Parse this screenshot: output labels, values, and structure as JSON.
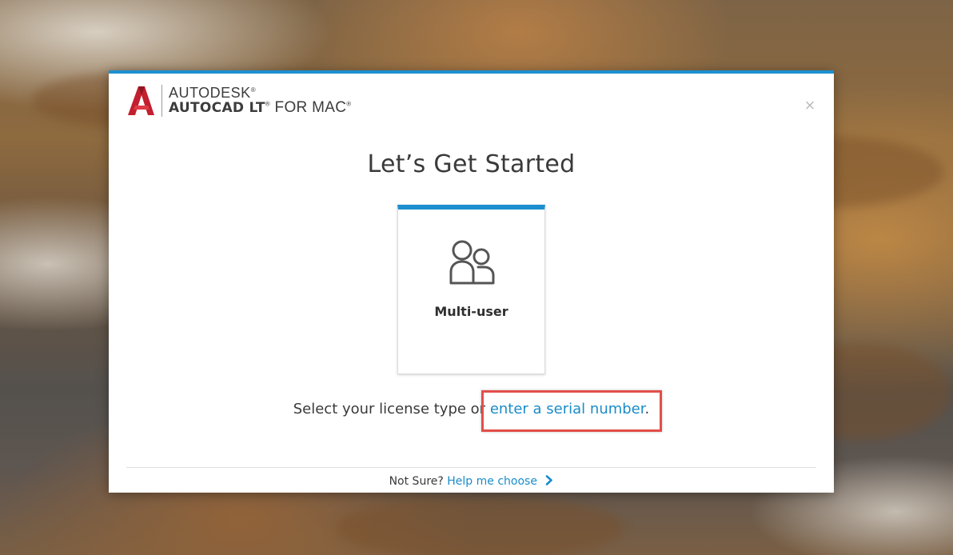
{
  "brand": {
    "company": "AUTODESK",
    "company_mark": "®",
    "product": "AUTOCAD LT",
    "product_mark": "®",
    "product_suffix": " FOR MAC",
    "product_suffix_mark": "®",
    "logo_color": "#c21f2f"
  },
  "dialog": {
    "accent_color": "#1d8fd0",
    "close_glyph": "×",
    "title": "Let’s Get Started"
  },
  "license_options": [
    {
      "icon": "multi-user-icon",
      "label": "Multi-user"
    }
  ],
  "prompt": {
    "static_text": "Select your license type or ",
    "link_text": "enter a serial number",
    "trailing": ".",
    "link_color": "#1a8cc9"
  },
  "annotation": {
    "highlight_color": "#e34e4a"
  },
  "footer": {
    "question": "Not Sure?",
    "link_text": "Help me choose"
  }
}
